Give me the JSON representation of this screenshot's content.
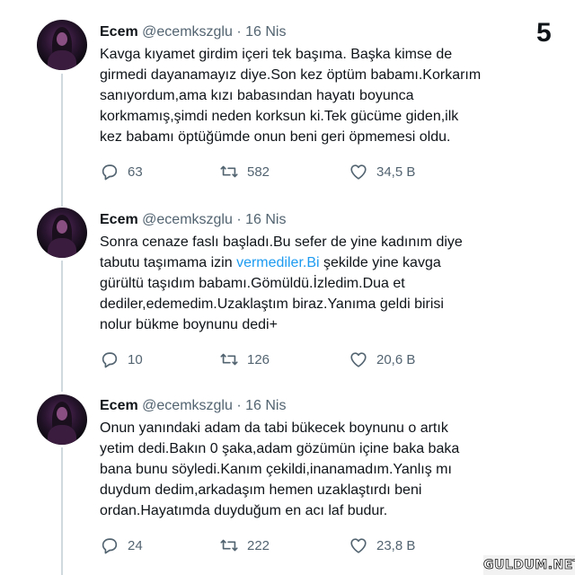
{
  "page_number": "5",
  "watermark": "GULDUM.NET",
  "tweets": [
    {
      "name": "Ecem",
      "handle": "@ecemkszglu",
      "date": "16 Nis",
      "text": "Kavga kıyamet girdim içeri tek başıma. Başka kimse de\ngirmedi dayanamayız diye.Son kez öptüm babamı.Korkarım\nsanıyordum,ama kızı babasından hayatı boyunca\nkorkmamış,şimdi neden korksun ki.Tek gücüme giden,ilk\nkez babamı öptüğümde onun beni geri öpmemesi oldu.",
      "replies": "63",
      "retweets": "582",
      "likes": "34,5 B"
    },
    {
      "name": "Ecem",
      "handle": "@ecemkszglu",
      "date": "16 Nis",
      "text_before_link": "Sonra cenaze faslı başladı.Bu sefer de yine kadınım diye\ntabutu taşımama izin ",
      "link": "vermediler.Bi",
      "text_after_link": " şekilde yine kavga\ngürültü taşıdım babamı.Gömüldü.İzledim.Dua et\ndediler,edemedim.Uzaklaştım biraz.Yanıma geldi birisi\nnolur bükme boynunu dedi+",
      "replies": "10",
      "retweets": "126",
      "likes": "20,6 B"
    },
    {
      "name": "Ecem",
      "handle": "@ecemkszglu",
      "date": "16 Nis",
      "text": "Onun yanındaki adam da tabi bükecek boynunu o artık\nyetim dedi.Bakın 0 şaka,adam gözümün içine baka baka\nbana bunu söyledi.Kanım çekildi,inanamadım.Yanlış mı\nduydum dedim,arkadaşım hemen uzaklaştırdı beni\nordan.Hayatımda duyduğum en acı laf budur.",
      "replies": "24",
      "retweets": "222",
      "likes": "23,8 B"
    }
  ],
  "icons": {
    "reply": "reply-icon",
    "retweet": "retweet-icon",
    "like": "like-icon"
  },
  "colors": {
    "text": "#0f1419",
    "secondary": "#536471",
    "link": "#1d9bf0",
    "thread_line": "#cfd9de"
  }
}
